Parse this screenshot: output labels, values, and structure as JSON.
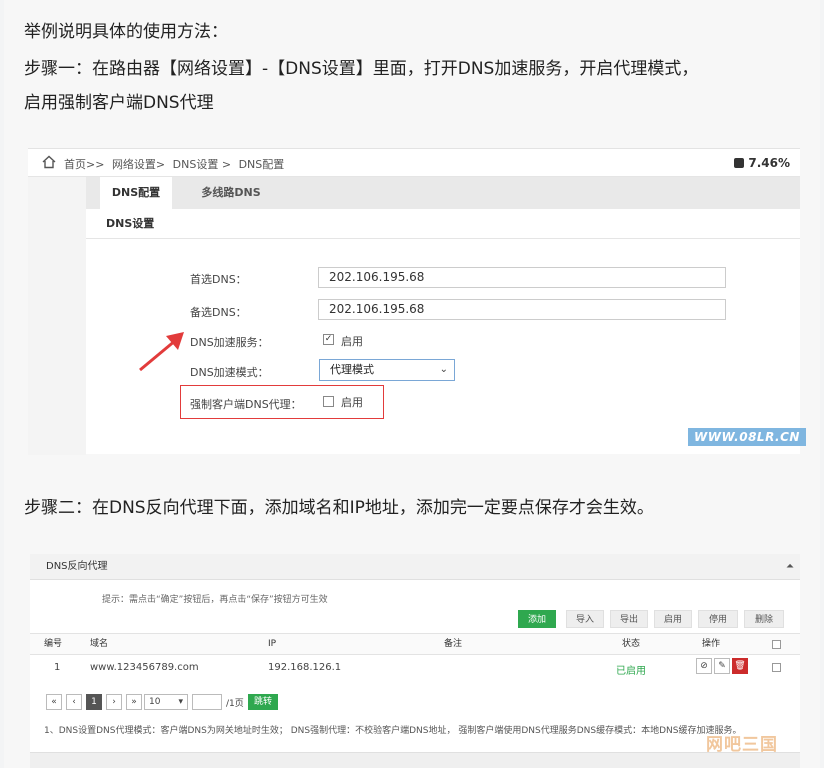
{
  "article": {
    "intro": "举例说明具体的使用方法：",
    "step1_line1": "步骤一：在路由器【网络设置】-【DNS设置】里面，打开DNS加速服务，开启代理模式，",
    "step1_line2": "启用强制客户端DNS代理",
    "step2": "步骤二：在DNS反向代理下面，添加域名和IP地址，添加完一定要点保存才会生效。"
  },
  "shot1": {
    "breadcrumb": [
      "首页>>",
      "网络设置>",
      "DNS设置 >",
      "DNS配置"
    ],
    "cpu": "7.46%",
    "tabs": [
      "DNS配置",
      "多线路DNS"
    ],
    "section": "DNS设置",
    "fields": {
      "primary_label": "首选DNS：",
      "primary_value": "202.106.195.68",
      "secondary_label": "备选DNS：",
      "secondary_value": "202.106.195.68",
      "accel_label": "DNS加速服务：",
      "accel_check_text": "启用",
      "accel_checked": true,
      "mode_label": "DNS加速模式：",
      "mode_value": "代理模式",
      "force_label": "强制客户端DNS代理：",
      "force_check_text": "启用",
      "force_checked": false
    },
    "watermark": "WWW.08LR.CN"
  },
  "shot2": {
    "title": "DNS反向代理",
    "tip": "提示：需点击“确定”按钮后，再点击“保存”按钮方可生效",
    "buttons": [
      "添加",
      "导入",
      "导出",
      "启用",
      "停用",
      "删除"
    ],
    "columns": [
      "编号",
      "域名",
      "IP",
      "备注",
      "状态",
      "操作"
    ],
    "rows": [
      {
        "no": "1",
        "domain": "www.123456789.com",
        "ip": "192.168.126.1",
        "note": "",
        "status": "已启用"
      }
    ],
    "pager": {
      "first": "«",
      "prev": "‹",
      "page": "1",
      "next": "›",
      "last": "»",
      "size": "10",
      "total": "/1页",
      "go": "跳转"
    },
    "footnote": "1、DNS设置DNS代理模式：客户端DNS为网关地址时生效； DNS强制代理：不校验客户端DNS地址， 强制客户端使用DNS代理服务DNS缓存模式：本地DNS缓存加速服务。",
    "watermark": "网吧三国"
  },
  "colors": {
    "accent_green": "#2fa84f",
    "highlight_red": "#e23b3b",
    "status_green": "#2fa84f"
  }
}
